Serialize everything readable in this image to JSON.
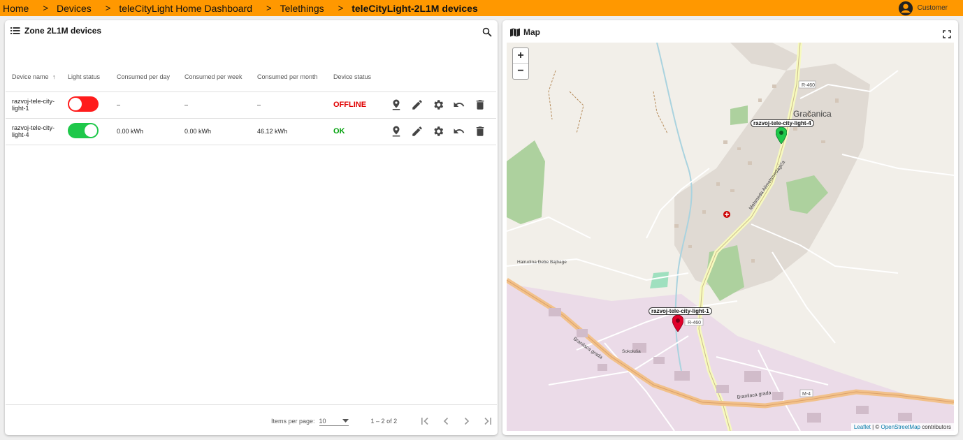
{
  "breadcrumb": {
    "items": [
      "Home",
      "Devices",
      "teleCityLight Home Dashboard",
      "Telethings",
      "teleCityLight-2L1M devices"
    ],
    "separator": ">"
  },
  "user": {
    "label": "Customer"
  },
  "devices_card": {
    "title": "Zone 2L1M devices",
    "columns": [
      "Device name",
      "Light status",
      "Consumed per day",
      "Consumed per week",
      "Consumed per month",
      "Device status"
    ],
    "rows": [
      {
        "name": "razvoj-tele-city-light-1",
        "light_on": false,
        "per_day": "–",
        "per_week": "–",
        "per_month": "–",
        "status": "OFFLINE"
      },
      {
        "name": "razvoj-tele-city-light-4",
        "light_on": true,
        "per_day": "0.00 kWh",
        "per_week": "0.00 kWh",
        "per_month": "46.12 kWh",
        "status": "OK"
      }
    ],
    "paginator": {
      "items_per_page_label": "Items per page:",
      "items_per_page_value": "10",
      "range_label": "1 – 2 of 2"
    },
    "icons": {
      "title": "list-icon",
      "search": "search-icon",
      "actions": [
        "location-icon",
        "edit-icon",
        "settings-icon",
        "undo-icon",
        "delete-icon"
      ]
    }
  },
  "map_card": {
    "title": "Map",
    "zoom_in": "+",
    "zoom_out": "−",
    "attribution": {
      "leaflet": "Leaflet",
      "separator": " | © ",
      "osm": "OpenStreetMap",
      "suffix": " contributors"
    },
    "markers": [
      {
        "label": "razvoj-tele-city-light-4",
        "color": "#1ec84a"
      },
      {
        "label": "razvoj-tele-city-light-1",
        "color": "#e0002a"
      }
    ],
    "place_labels": {
      "town": "Gračanica",
      "road_r460_a": "R-460",
      "road_r460_b": "R-460",
      "road_m4": "M-4",
      "street_1": "Branilaca grada",
      "street_2": "Branilaca grada",
      "street_3": "Mehmeda Alimehmedagića",
      "street_4": "Hairudina Đebe Bajbage",
      "street_5": "Sokoluša"
    }
  },
  "colors": {
    "topbar": "#ff9800",
    "offline": "#e00000",
    "ok": "#00a00a",
    "toggle_off": "#ff1c1c",
    "toggle_on": "#1ec84a"
  }
}
